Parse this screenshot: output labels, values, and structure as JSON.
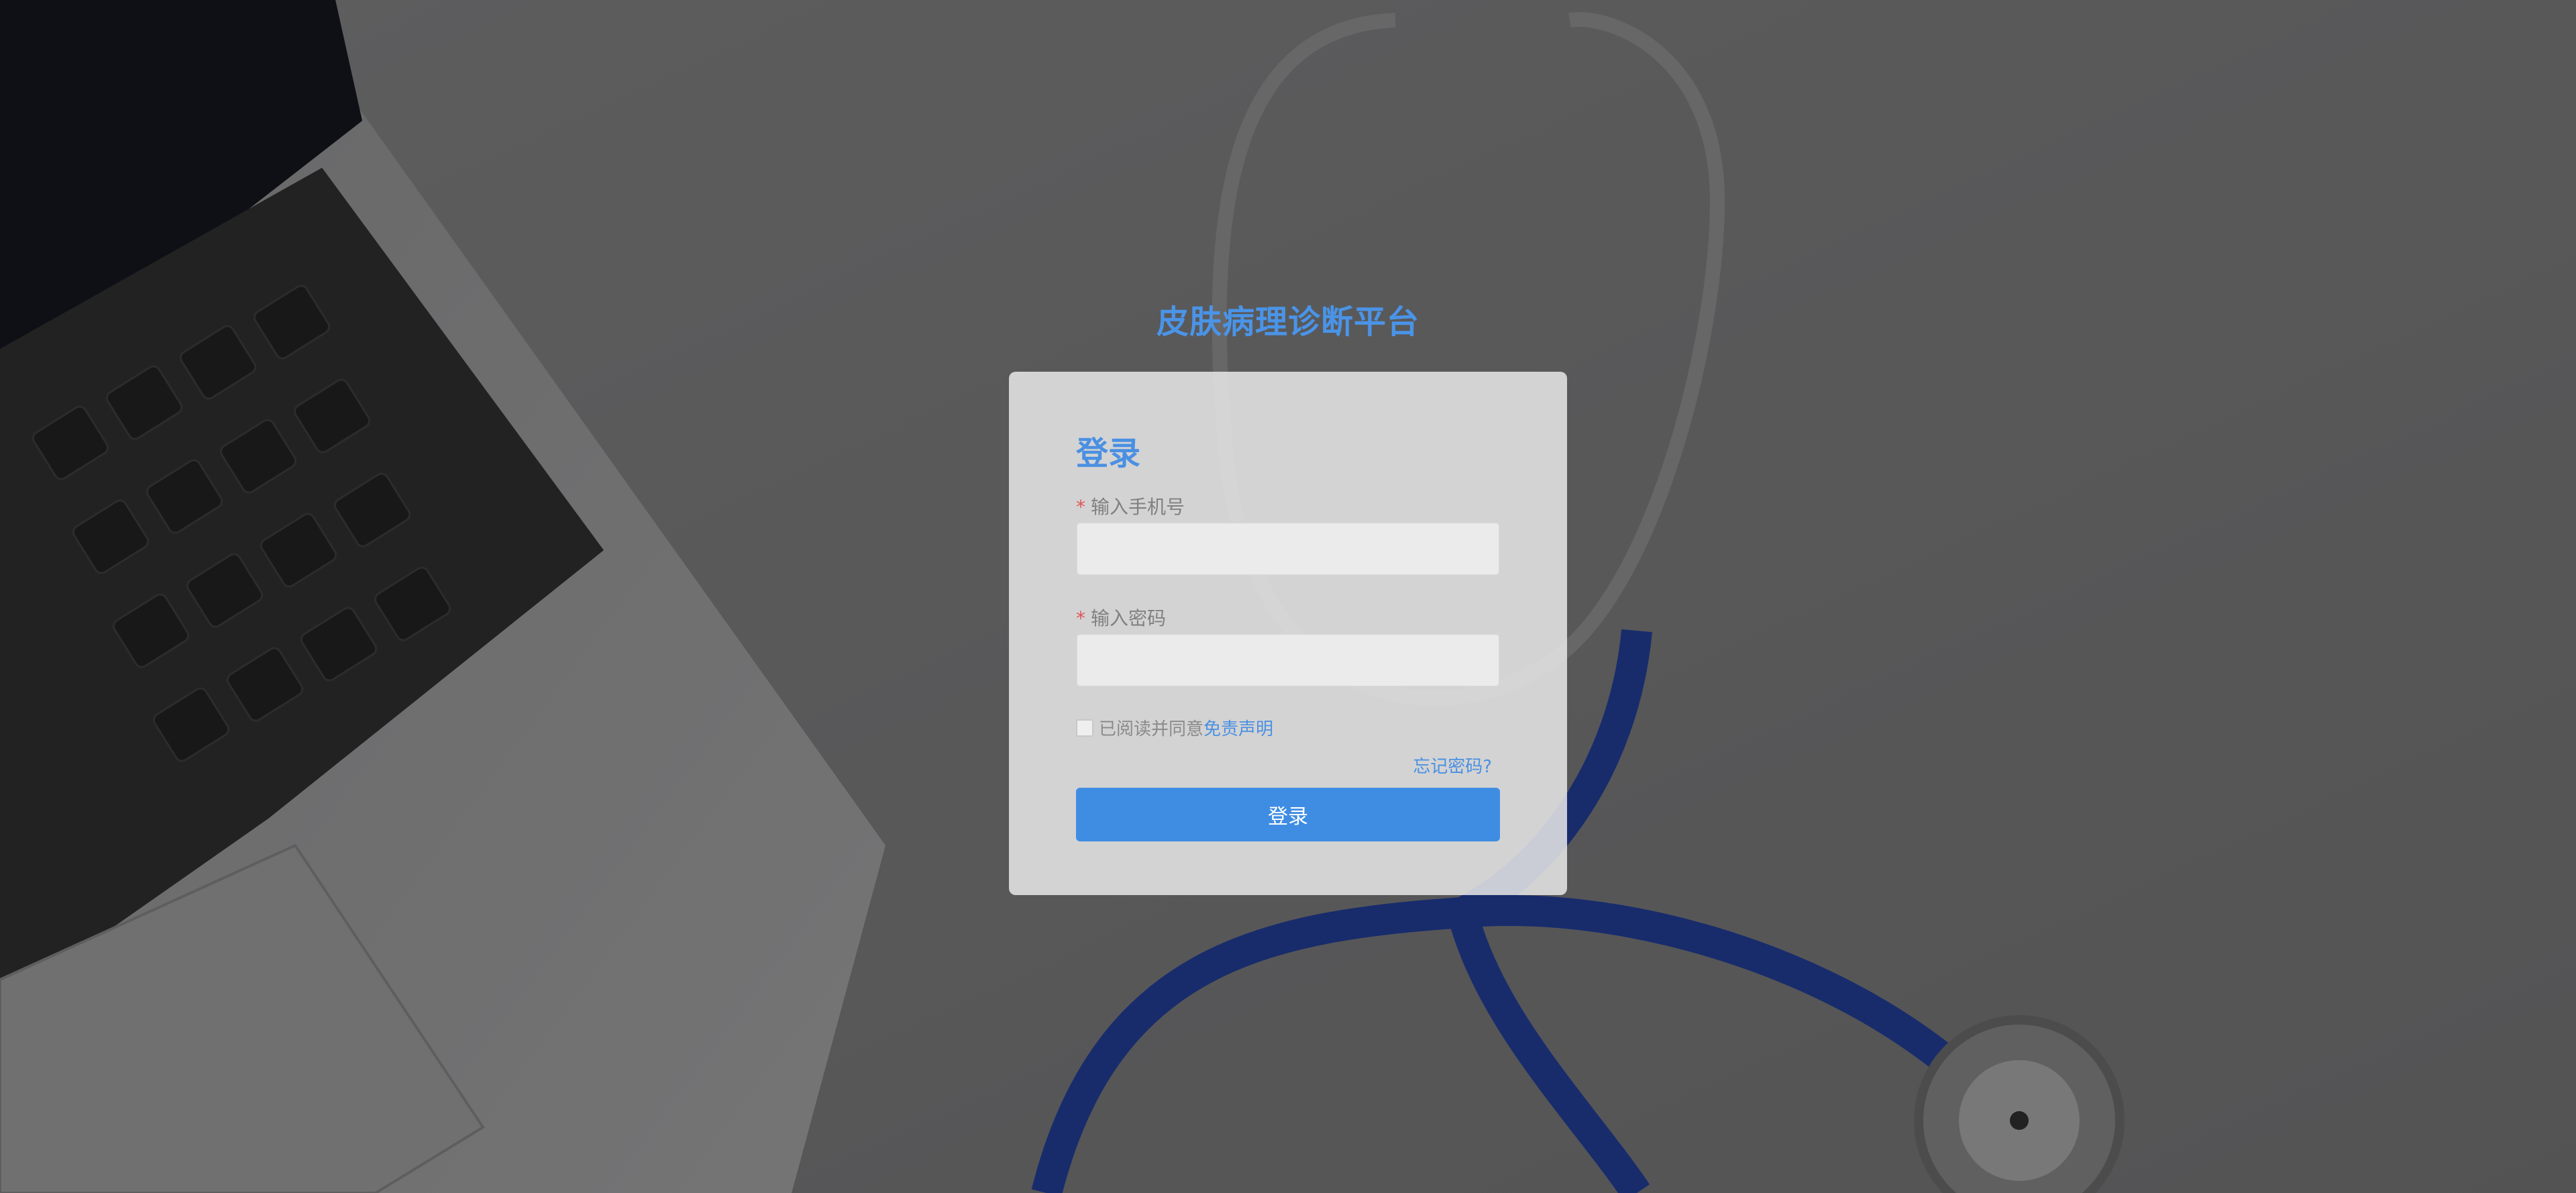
{
  "app": {
    "platform_title": "皮肤病理诊断平台"
  },
  "login_card": {
    "title": "登录",
    "phone_field": {
      "required_marker": "*",
      "label": "输入手机号",
      "value": "",
      "placeholder": ""
    },
    "password_field": {
      "required_marker": "*",
      "label": "输入密码",
      "value": "",
      "placeholder": ""
    },
    "agreement": {
      "checked": false,
      "text": "已阅读并同意",
      "link_text": "免责声明"
    },
    "forgot_password": "忘记密码?",
    "submit_label": "登录"
  },
  "colors": {
    "accent": "#4a90e2",
    "button": "#3f8de3",
    "required": "#e05555",
    "stethoscope_tube": "#1a3aa0"
  },
  "icons": {
    "checkbox": "checkbox-unchecked-icon"
  }
}
